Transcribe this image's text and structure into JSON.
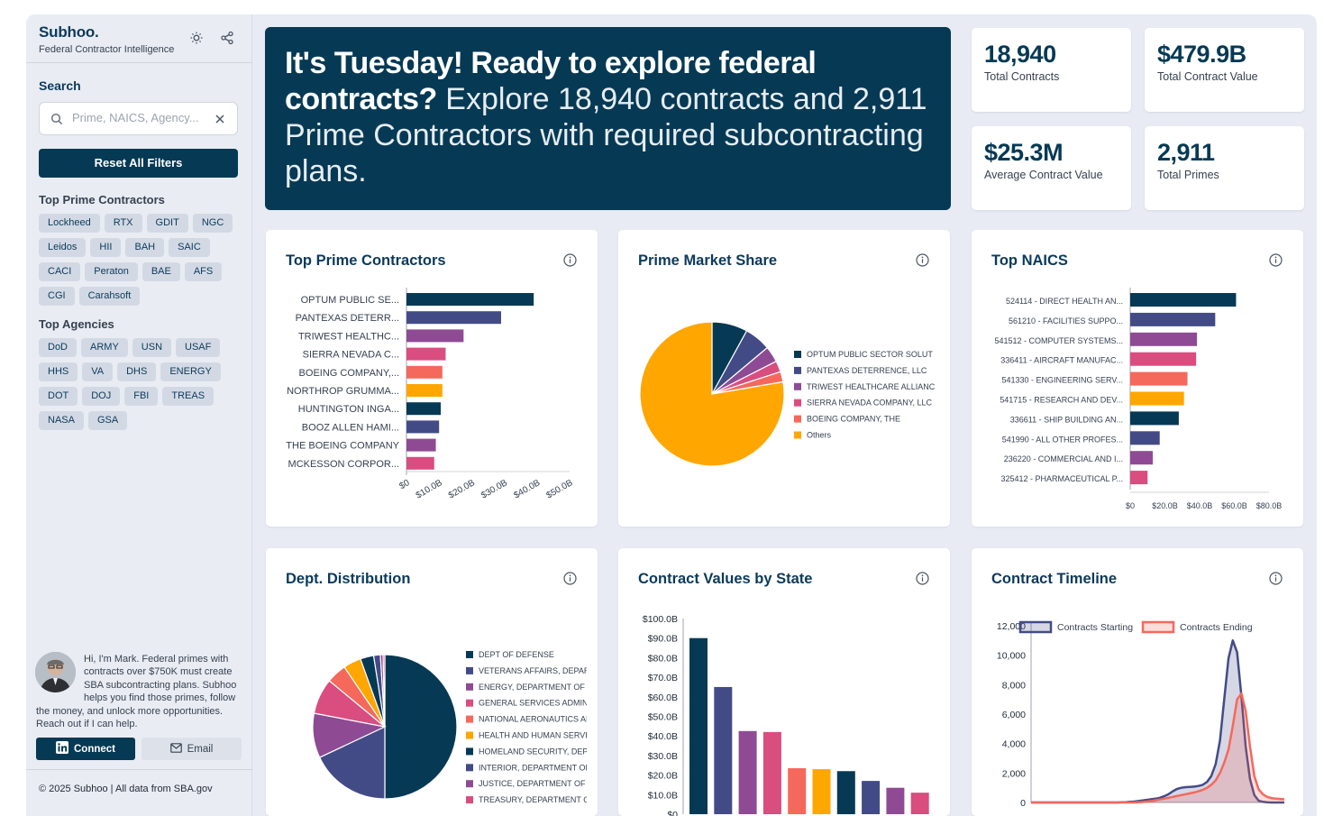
{
  "brand": {
    "title": "Subhoo.",
    "subtitle": "Federal Contractor Intelligence"
  },
  "icons": {
    "theme": "sun-icon",
    "share": "share-icon",
    "search": "search-icon",
    "clear": "close-icon",
    "info": "info-icon",
    "linkedin": "linkedin-icon",
    "email": "mail-icon"
  },
  "search": {
    "label": "Search",
    "placeholder": "Prime, NAICS, Agency...",
    "value": ""
  },
  "reset_label": "Reset All Filters",
  "top_primes_label": "Top Prime Contractors",
  "top_primes": [
    "Lockheed",
    "RTX",
    "GDIT",
    "NGC",
    "Leidos",
    "HII",
    "BAH",
    "SAIC",
    "CACI",
    "Peraton",
    "BAE",
    "AFS",
    "CGI",
    "Carahsoft"
  ],
  "top_agencies_label": "Top Agencies",
  "top_agencies": [
    "DoD",
    "ARMY",
    "USN",
    "USAF",
    "HHS",
    "VA",
    "DHS",
    "ENERGY",
    "DOT",
    "DOJ",
    "FBI",
    "TREAS",
    "NASA",
    "GSA"
  ],
  "bio": "Hi, I'm Mark. Federal primes with contracts over $750K must create SBA subcontracting plans. Subhoo helps you find those primes, follow the money, and unlock more opportunities. Reach out if I can help.",
  "connect_label": "Connect",
  "email_label": "Email",
  "footer": "© 2025 Subhoo | All data from SBA.gov",
  "hero": {
    "strong": "It's Tuesday! Ready to explore federal contracts?",
    "light": "Explore 18,940 contracts and 2,911 Prime Contractors with required subcontracting plans."
  },
  "stats": [
    {
      "value": "18,940",
      "label": "Total Contracts"
    },
    {
      "value": "$479.9B",
      "label": "Total Contract Value"
    },
    {
      "value": "$25.3M",
      "label": "Average Contract Value"
    },
    {
      "value": "2,911",
      "label": "Total Primes"
    }
  ],
  "palette": [
    "#063954",
    "#434b86",
    "#8e4b94",
    "#d94d7f",
    "#f5685c",
    "#ffa600"
  ],
  "chart_data": [
    {
      "id": "top-primes",
      "type": "bar",
      "orientation": "horizontal",
      "title": "Top Prime Contractors",
      "categories": [
        "OPTUM PUBLIC SE...",
        "PANTEXAS DETERR...",
        "TRIWEST HEALTHC...",
        "SIERRA NEVADA C...",
        "BOEING COMPANY,...",
        "NORTHROP GRUMMA...",
        "HUNTINGTON INGA...",
        "BOOZ ALLEN HAMI...",
        "THE BOEING COMPANY",
        "MCKESSON CORPOR..."
      ],
      "values": [
        39,
        29,
        17.5,
        12,
        11,
        11,
        10.5,
        10,
        9,
        8.5
      ],
      "ticks": [
        "$0",
        "$10.0B",
        "$20.0B",
        "$30.0B",
        "$40.0B",
        "$50.0B"
      ],
      "xlim": [
        0,
        50
      ]
    },
    {
      "id": "market-share",
      "type": "pie",
      "title": "Prime Market Share",
      "legend": "right",
      "labels": [
        "OPTUM PUBLIC SECTOR SOLUT",
        "PANTEXAS DETERRENCE, LLC",
        "TRIWEST HEALTHCARE ALLIANC",
        "SIERRA NEVADA COMPANY, LLC",
        "BOEING COMPANY, THE",
        "Others"
      ],
      "values": [
        8.0,
        5.9,
        3.6,
        2.5,
        2.3,
        77.7
      ]
    },
    {
      "id": "top-naics",
      "type": "bar",
      "orientation": "horizontal",
      "title": "Top NAICS",
      "categories": [
        "524114 - DIRECT HEALTH AN...",
        "561210 - FACILITIES SUPPO...",
        "541512 - COMPUTER SYSTEMS...",
        "336411 - AIRCRAFT MANUFAC...",
        "541330 - ENGINEERING SERV...",
        "541715 - RESEARCH AND DEV...",
        "336611 - SHIP BUILDING AN...",
        "541990 - ALL OTHER PROFES...",
        "236220 - COMMERCIAL AND I...",
        "325412 - PHARMACEUTICAL P..."
      ],
      "values": [
        61,
        49,
        38.5,
        38,
        33,
        31,
        28,
        17,
        13,
        10
      ],
      "ticks": [
        "$0",
        "$20.0B",
        "$40.0B",
        "$60.0B",
        "$80.0B"
      ],
      "xlim": [
        0,
        80
      ]
    },
    {
      "id": "dept-distribution",
      "type": "pie",
      "title": "Dept. Distribution",
      "legend": "right",
      "labels": [
        "DEPT OF DEFENSE",
        "VETERANS AFFAIRS, DEPARTME",
        "ENERGY, DEPARTMENT OF",
        "GENERAL SERVICES ADMINISTI",
        "NATIONAL AERONAUTICS AND S",
        "HEALTH AND HUMAN SERVICES",
        "HOMELAND SECURITY, DEPART",
        "INTERIOR, DEPARTMENT OF TH",
        "JUSTICE, DEPARTMENT OF",
        "TREASURY, DEPARTMENT OF TI"
      ],
      "values": [
        50,
        18,
        10,
        8,
        4.5,
        4,
        3,
        1.5,
        0.6,
        0.4
      ]
    },
    {
      "id": "state-values",
      "type": "bar",
      "title": "Contract Values by State",
      "values": [
        90,
        65,
        42.5,
        42,
        23.5,
        23,
        22,
        17,
        13.5,
        11
      ],
      "ticks": [
        "$0",
        "$10.0B",
        "$20.0B",
        "$30.0B",
        "$40.0B",
        "$50.0B",
        "$60.0B",
        "$70.0B",
        "$80.0B",
        "$90.0B",
        "$100.0B"
      ],
      "ylim": [
        0,
        100
      ]
    },
    {
      "id": "timeline",
      "type": "area",
      "title": "Contract Timeline",
      "legend": "top",
      "series": [
        {
          "name": "Contracts Starting",
          "values": [
            0,
            0,
            0,
            0,
            0,
            0,
            0,
            0,
            0,
            0,
            0,
            0,
            0,
            0,
            0,
            0,
            0,
            0,
            0,
            0,
            0,
            10,
            20,
            40,
            60,
            100,
            140,
            180,
            220,
            260,
            320,
            420,
            560,
            760,
            920,
            1000,
            1040,
            1060,
            1080,
            1120,
            1200,
            1400,
            1800,
            2600,
            4200,
            7000,
            9800,
            11000,
            10200,
            7200,
            3800,
            1600,
            500,
            120,
            40,
            10,
            0,
            0,
            0,
            0
          ]
        },
        {
          "name": "Contracts Ending",
          "values": [
            0,
            0,
            0,
            0,
            0,
            0,
            0,
            0,
            0,
            0,
            0,
            0,
            0,
            0,
            0,
            0,
            0,
            0,
            0,
            0,
            0,
            0,
            0,
            0,
            0,
            10,
            30,
            60,
            100,
            150,
            200,
            260,
            320,
            380,
            440,
            500,
            560,
            620,
            680,
            760,
            860,
            1000,
            1200,
            1500,
            2000,
            2700,
            3600,
            5200,
            7000,
            7400,
            6200,
            3800,
            1800,
            900,
            560,
            380,
            300,
            260,
            240,
            220
          ]
        }
      ],
      "ticks": [
        "0",
        "2,000",
        "4,000",
        "6,000",
        "8,000",
        "10,000",
        "12,000"
      ],
      "ylim": [
        0,
        12000
      ]
    }
  ]
}
